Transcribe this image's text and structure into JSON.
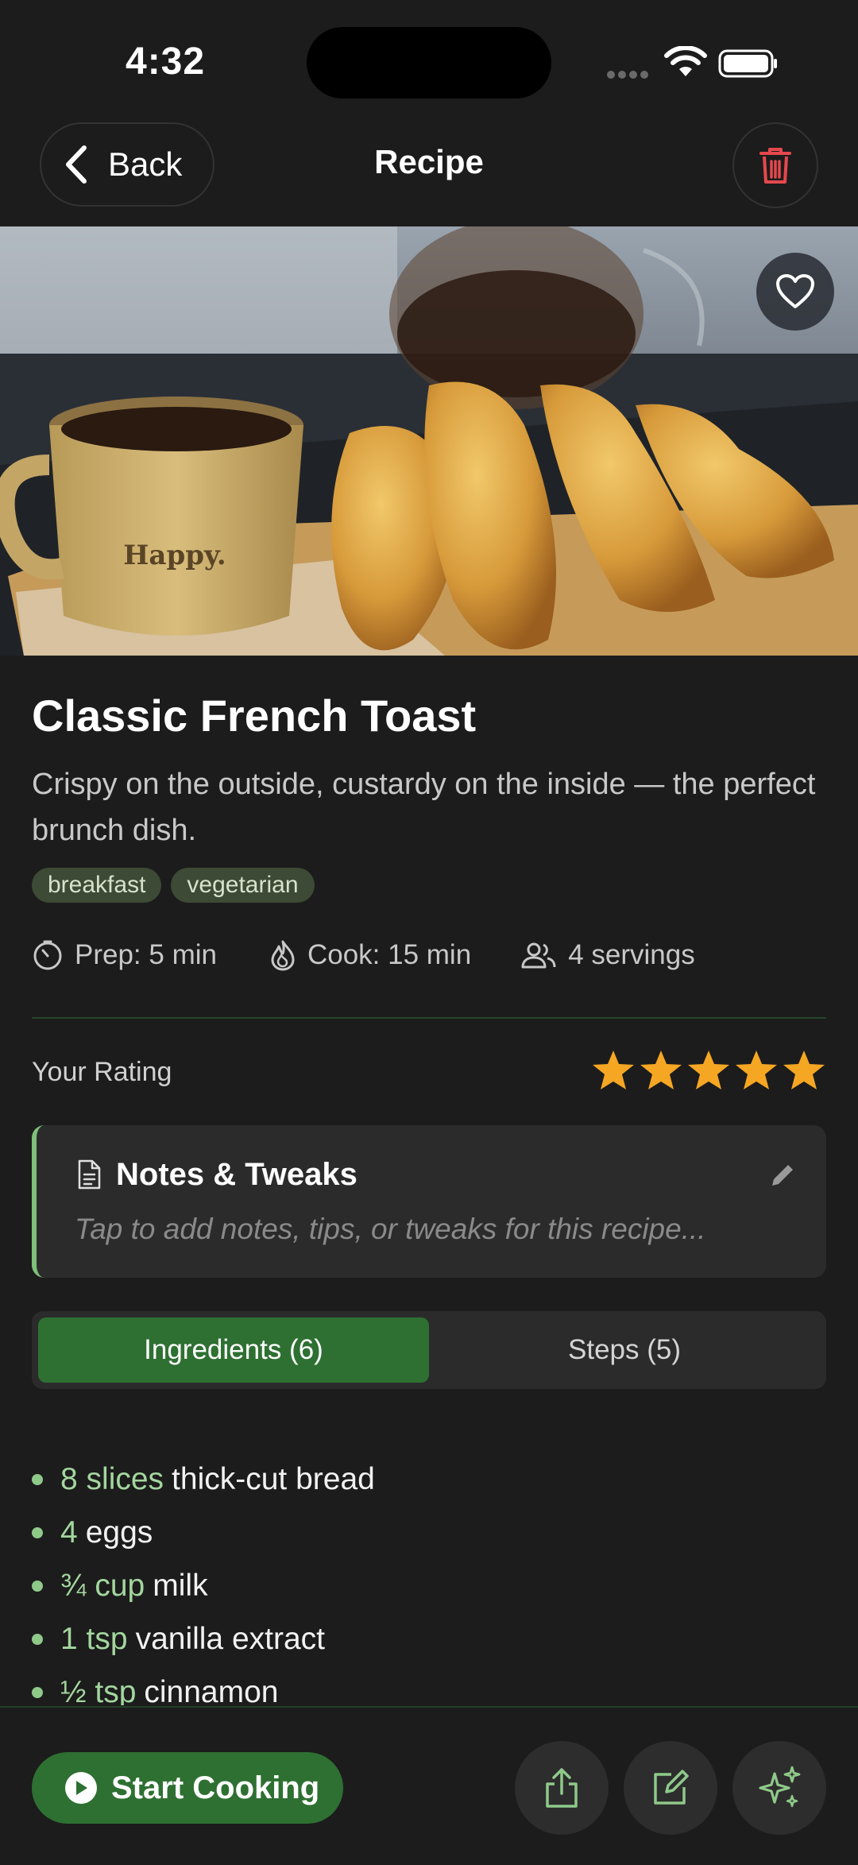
{
  "status_bar": {
    "time": "4:32"
  },
  "nav": {
    "back_label": "Back",
    "title": "Recipe"
  },
  "recipe": {
    "title": "Classic French Toast",
    "description": "Crispy on the outside, custardy on the inside — the perfect brunch dish.",
    "tags": [
      "breakfast",
      "vegetarian"
    ],
    "prep": "Prep: 5 min",
    "cook": "Cook: 15 min",
    "servings": "4 servings",
    "mug_text": "Happy."
  },
  "rating": {
    "label": "Your Rating",
    "value": 5,
    "max": 5
  },
  "notes": {
    "title": "Notes & Tweaks",
    "placeholder": "Tap to add notes, tips, or tweaks for this recipe..."
  },
  "tabs": [
    {
      "label": "Ingredients (6)",
      "active": true
    },
    {
      "label": "Steps (5)",
      "active": false
    }
  ],
  "ingredients": [
    {
      "qty": "8 slices",
      "name": "thick-cut bread"
    },
    {
      "qty": "4",
      "name": "eggs"
    },
    {
      "qty": "¾ cup",
      "name": "milk"
    },
    {
      "qty": "1 tsp",
      "name": "vanilla extract"
    },
    {
      "qty": "½ tsp",
      "name": "cinnamon"
    }
  ],
  "bottom_bar": {
    "start_label": "Start Cooking"
  },
  "colors": {
    "accent": "#2e7032",
    "star": "#f5a623",
    "trash": "#e5484d",
    "ingredient_qty": "#a3d69e"
  },
  "icons": {
    "back": "chevron-left-icon",
    "delete": "trash-icon",
    "favorite": "heart-icon",
    "prep": "timer-icon",
    "cook": "flame-icon",
    "servings": "people-icon",
    "notes": "document-icon",
    "edit_notes": "pencil-icon",
    "start": "play-icon",
    "share": "share-icon",
    "edit": "edit-icon",
    "ai": "sparkles-icon"
  }
}
